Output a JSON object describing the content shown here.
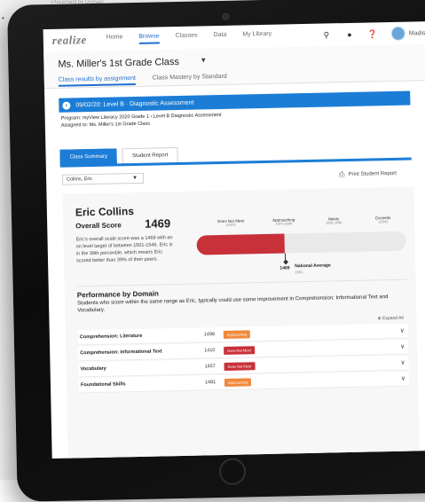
{
  "background": {
    "top_text": "Placement by Domain"
  },
  "nav": {
    "logo": "realize",
    "items": [
      "Home",
      "Browse",
      "Classes",
      "Data",
      "My Library"
    ],
    "active_item": "Browse",
    "user_name": "Madison ▾"
  },
  "classbar": {
    "title": "Ms. Miller's 1st Grade Class",
    "tabs": [
      "Class results by assignment",
      "Class Mastery by Standard"
    ]
  },
  "assessment": {
    "header": "09/02/20: Level B · Diagnostic Assessment",
    "program": "Program: myView Literacy 2020 Grade 1 › Level B Diagnostic Assessment",
    "assigned_to": "Assigned to: Ms. Miller's 1st Grade Class"
  },
  "tabs": [
    "Class Summary",
    "Student Report"
  ],
  "student_select": {
    "value": "Collins, Eric"
  },
  "print_label": "Print Student Report",
  "student": {
    "name": "Eric Collins",
    "overall_label": "Overall Score",
    "overall_score": "1469",
    "description": "Eric's overall scale score was a 1469 with an on level target of between 1501-1546. Eric is in the 39th percentile, which means Eric scored better than 39% of their peers."
  },
  "scale": {
    "levels": [
      {
        "label": "Does Not Meet",
        "range": "≤1470"
      },
      {
        "label": "Approaching",
        "range": "1471-1500"
      },
      {
        "label": "Meets",
        "range": "1501-1540"
      },
      {
        "label": "Exceeds",
        "range": "≥1541"
      }
    ],
    "marker_value": "1469",
    "fill_fraction": 0.42,
    "national_average_label": "National Average",
    "national_average_value": "1501"
  },
  "performance": {
    "title": "Performance by Domain",
    "description": "Students who score within the same range as Eric, typically could use some improvement in Comprehension: Informational Text and Vocabulary.",
    "expand_label": "Expand All",
    "rows": [
      {
        "domain": "Comprehension: Literature",
        "score": "1498",
        "status": "Approaching",
        "color": "#f08a3c"
      },
      {
        "domain": "Comprehension: Informational Text",
        "score": "1410",
        "status": "Does Not Meet",
        "color": "#c8313a"
      },
      {
        "domain": "Vocabulary",
        "score": "1457",
        "status": "Does Not Meet",
        "color": "#c8313a"
      },
      {
        "domain": "Foundational Skills",
        "score": "1481",
        "status": "Approaching",
        "color": "#f08a3c"
      }
    ]
  },
  "colors": {
    "brand": "#1c7dd6",
    "does_not_meet": "#c8313a",
    "approaching": "#f08a3c"
  }
}
